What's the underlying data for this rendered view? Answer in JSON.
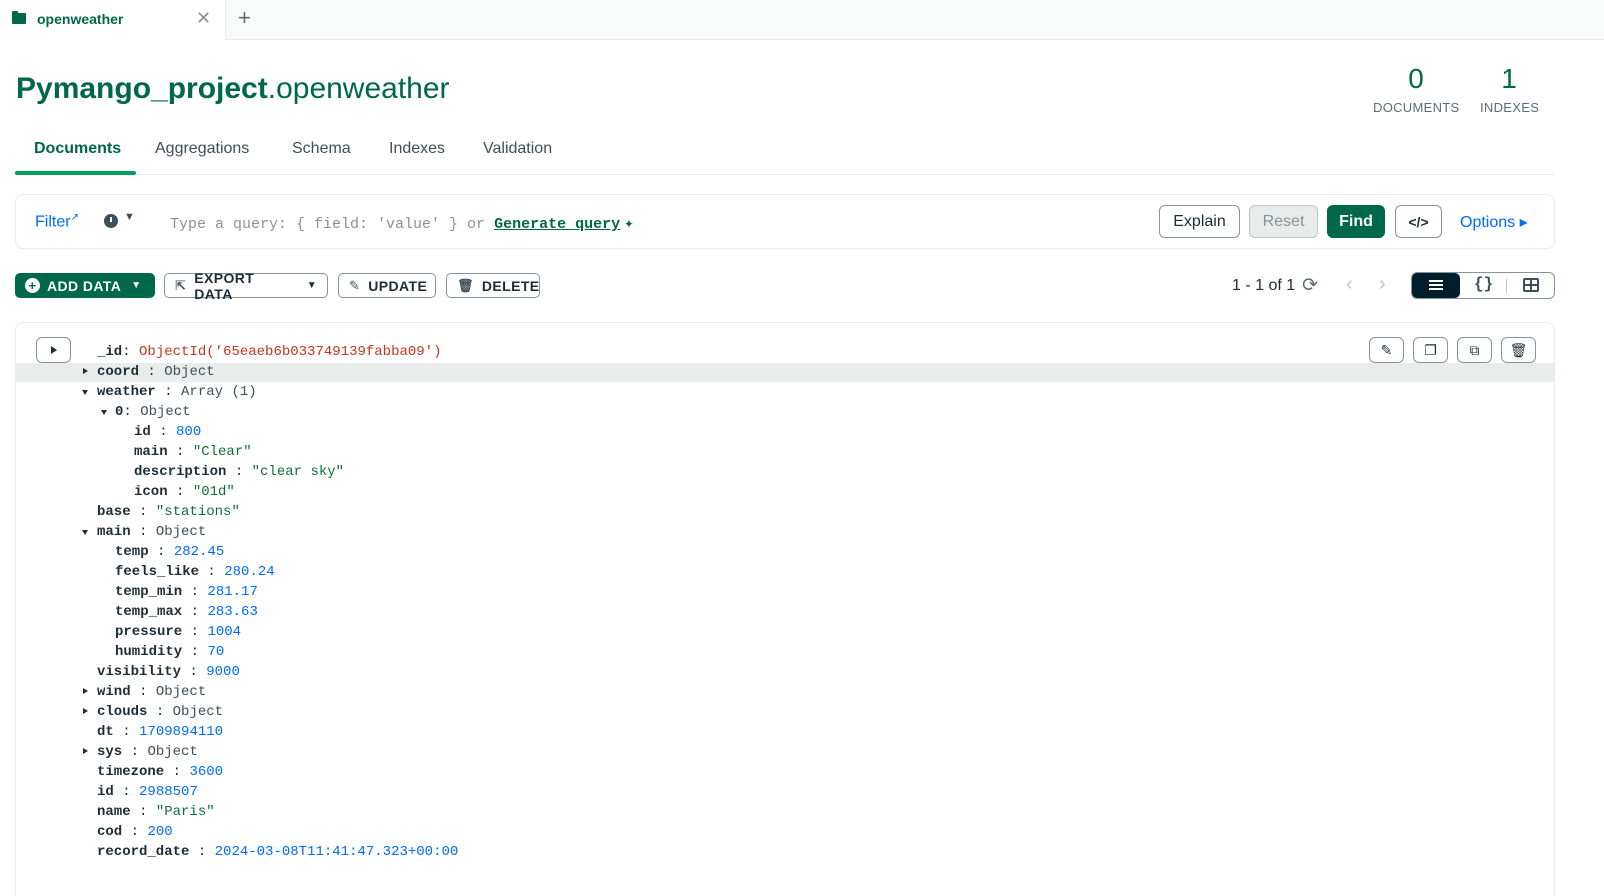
{
  "tab": {
    "label": "openweather"
  },
  "header": {
    "db": "Pymango_project",
    "collection": ".openweather"
  },
  "stats": [
    {
      "value": "0",
      "label": "DOCUMENTS"
    },
    {
      "value": "1",
      "label": "INDEXES"
    }
  ],
  "subtabs": [
    "Documents",
    "Aggregations",
    "Schema",
    "Indexes",
    "Validation"
  ],
  "query": {
    "filter_label": "Filter",
    "placeholder": "Type a query: { field: 'value' } or ",
    "generate_label": "Generate query",
    "explain": "Explain",
    "reset": "Reset",
    "find": "Find",
    "options": "Options"
  },
  "toolbar": {
    "add": "ADD DATA",
    "export": "EXPORT DATA",
    "update": "UPDATE",
    "delete": "DELETE",
    "pagination": "1 - 1 of 1"
  },
  "document": {
    "id_key": "_id",
    "id_value": "ObjectId('65eaeb6b033749139fabba09')",
    "fields": [
      {
        "key": "coord",
        "type": "Object"
      },
      {
        "key": "weather",
        "type": "Array (1)"
      },
      {
        "key": "0",
        "type": "Object"
      },
      {
        "key": "id",
        "value": "800"
      },
      {
        "key": "main",
        "value": "\"Clear\""
      },
      {
        "key": "description",
        "value": "\"clear sky\""
      },
      {
        "key": "icon",
        "value": "\"01d\""
      },
      {
        "key": "base",
        "value": "\"stations\""
      },
      {
        "key": "main",
        "type": "Object"
      },
      {
        "key": "temp",
        "value": "282.45"
      },
      {
        "key": "feels_like",
        "value": "280.24"
      },
      {
        "key": "temp_min",
        "value": "281.17"
      },
      {
        "key": "temp_max",
        "value": "283.63"
      },
      {
        "key": "pressure",
        "value": "1004"
      },
      {
        "key": "humidity",
        "value": "70"
      },
      {
        "key": "visibility",
        "value": "9000"
      },
      {
        "key": "wind",
        "type": "Object"
      },
      {
        "key": "clouds",
        "type": "Object"
      },
      {
        "key": "dt",
        "value": "1709894110"
      },
      {
        "key": "sys",
        "type": "Object"
      },
      {
        "key": "timezone",
        "value": "3600"
      },
      {
        "key": "id",
        "value": "2988507"
      },
      {
        "key": "name",
        "value": "\"Paris\""
      },
      {
        "key": "cod",
        "value": "200"
      },
      {
        "key": "record_date",
        "value": "2024-03-08T11:41:47.323+00:00"
      }
    ]
  },
  "colors": {
    "brand": "#00684a",
    "accent_underline": "#00a35c",
    "link": "#016bf8",
    "objectid": "#c6341e",
    "string": "#0e6e3a"
  }
}
